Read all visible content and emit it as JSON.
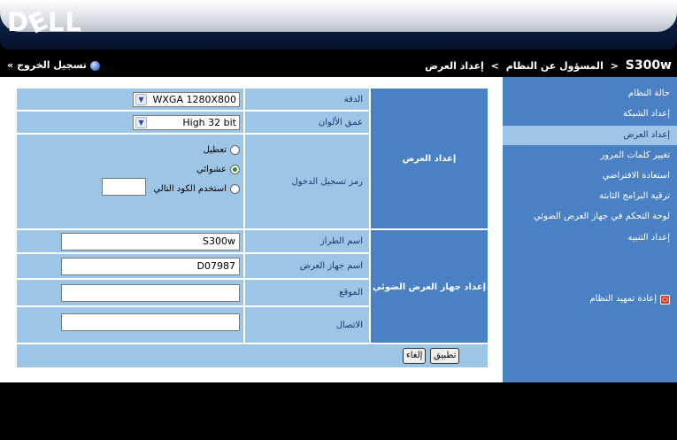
{
  "brand": {
    "logo_before": "D",
    "logo_e": "E",
    "logo_after": "LL"
  },
  "topbar": {
    "model": "S300w",
    "sep1": "<",
    "crumb1": "المسؤول عن النظام",
    "sep2": ">",
    "crumb2": "إعداد العرض",
    "logout_label": "تسجيل الخروج",
    "logout_chevron": "»"
  },
  "sidebar": {
    "items": [
      {
        "label": "حالة النظام",
        "active": false
      },
      {
        "label": "إعداد الشبكة",
        "active": false
      },
      {
        "label": "إعداد العرض",
        "active": true
      },
      {
        "label": "تغيير كلمات المرور",
        "active": false
      },
      {
        "label": "استعادة الافتراضي",
        "active": false
      },
      {
        "label": "ترقية البرامج الثابتة",
        "active": false
      },
      {
        "label": "لوحة التحكم في جهاز العرض الضوئي",
        "active": false
      },
      {
        "label": "إعداد التنبيه",
        "active": false
      }
    ],
    "restart_label": "إعادة تمهيد النظام",
    "restart_icon": "power-icon"
  },
  "form": {
    "section_display": "إعداد العرض",
    "section_projector": "إعداد جهاز العرض الضوئي",
    "resolution": {
      "label": "الدقة",
      "value": "WXGA 1280X800"
    },
    "color_depth": {
      "label": "عمق الألوان",
      "value": "High 32 bit"
    },
    "login_code": {
      "label": "رمز تسجيل الدخول",
      "options": [
        "تعطيل",
        "عشوائي",
        "استخدم الكود التالي"
      ],
      "selected": "عشوائي",
      "code_value": ""
    },
    "model_name": {
      "label": "اسم الطراز",
      "value": "S300w"
    },
    "projector_name": {
      "label": "اسم جهاز العرض",
      "value": "D07987"
    },
    "location": {
      "label": "الموقع",
      "value": ""
    },
    "contact": {
      "label": "الاتصال",
      "value": ""
    },
    "apply_label": "تطبيق",
    "cancel_label": "إلغاء"
  },
  "colors": {
    "sidebar_bg": "#4a80c4",
    "panel_bg": "#9cc5e6",
    "header_dark": "#0c1c3e"
  }
}
